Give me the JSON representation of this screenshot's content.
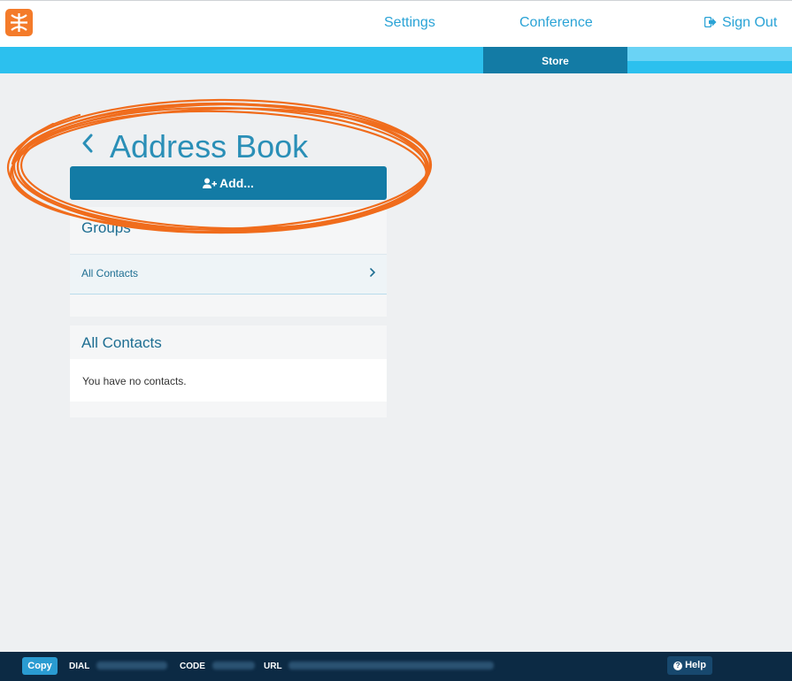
{
  "nav": {
    "settings": "Settings",
    "conference": "Conference",
    "signout": "Sign Out",
    "store": "Store"
  },
  "page": {
    "title": "Address Book",
    "add_label": "Add..."
  },
  "groups": {
    "title": "Groups",
    "items": [
      {
        "label": "All Contacts"
      }
    ]
  },
  "contacts": {
    "title": "All Contacts",
    "empty": "You have no contacts."
  },
  "footer": {
    "copy": "Copy",
    "dial_label": "DIAL",
    "code_label": "CODE",
    "url_label": "URL",
    "help": "Help"
  },
  "colors": {
    "brand_orange": "#f47b2a",
    "accent_blue": "#2cc0ee",
    "dark_blue": "#137ba5",
    "footer_bg": "#0c2a44"
  },
  "icons": [
    "logo-icon",
    "sign-out-icon",
    "back-chevron-icon",
    "add-user-icon",
    "chevron-right-icon",
    "help-icon"
  ]
}
